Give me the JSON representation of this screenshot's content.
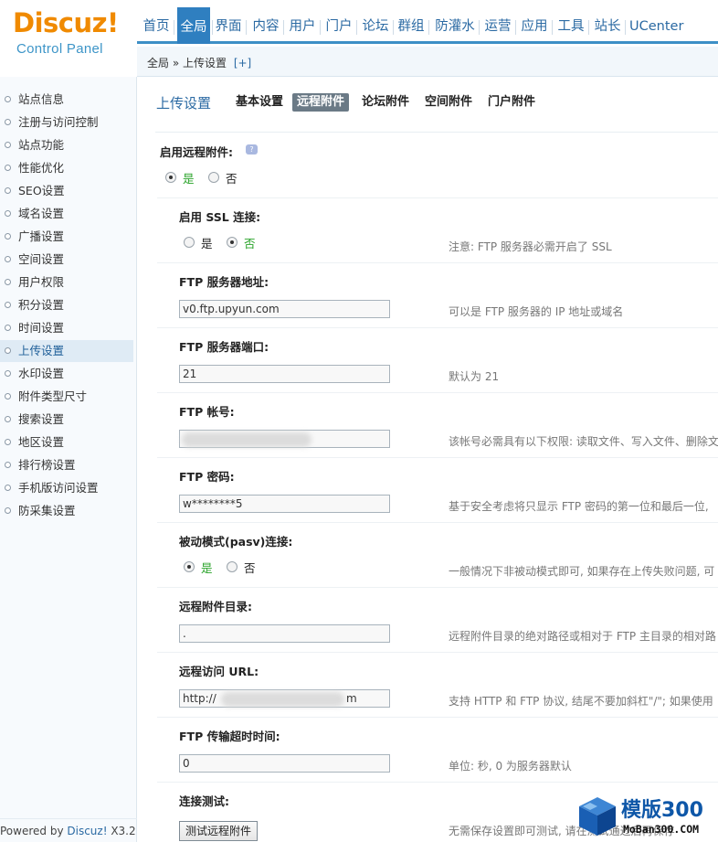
{
  "logo": {
    "brand": "Discuz",
    "bang": "!",
    "subtitle": "Control Panel"
  },
  "topnav": [
    {
      "label": "首页"
    },
    {
      "label": "全局"
    },
    {
      "label": "界面"
    },
    {
      "label": "内容"
    },
    {
      "label": "用户"
    },
    {
      "label": "门户"
    },
    {
      "label": "论坛"
    },
    {
      "label": "群组"
    },
    {
      "label": "防灌水"
    },
    {
      "label": "运营"
    },
    {
      "label": "应用"
    },
    {
      "label": "工具"
    },
    {
      "label": "站长"
    },
    {
      "label": "UCenter"
    }
  ],
  "active_topnav": "全局",
  "breadcrumb": {
    "path": "全局 » 上传设置",
    "add": "[+]"
  },
  "sidebar": {
    "items": [
      {
        "label": "站点信息"
      },
      {
        "label": "注册与访问控制"
      },
      {
        "label": "站点功能"
      },
      {
        "label": "性能优化"
      },
      {
        "label": "SEO设置"
      },
      {
        "label": "域名设置"
      },
      {
        "label": "广播设置"
      },
      {
        "label": "空间设置"
      },
      {
        "label": "用户权限"
      },
      {
        "label": "积分设置"
      },
      {
        "label": "时间设置"
      },
      {
        "label": "上传设置"
      },
      {
        "label": "水印设置"
      },
      {
        "label": "附件类型尺寸"
      },
      {
        "label": "搜索设置"
      },
      {
        "label": "地区设置"
      },
      {
        "label": "排行榜设置"
      },
      {
        "label": "手机版访问设置"
      },
      {
        "label": "防采集设置"
      }
    ],
    "active": "上传设置",
    "footer": {
      "prefix": "Powered by ",
      "brand": "Discuz!",
      "version": " X3.2"
    }
  },
  "subnav": {
    "title": "上传设置",
    "tabs": [
      {
        "label": "基本设置"
      },
      {
        "label": "远程附件"
      },
      {
        "label": "论坛附件"
      },
      {
        "label": "空间附件"
      },
      {
        "label": "门户附件"
      }
    ],
    "active_tab": "远程附件"
  },
  "form": {
    "enable_remote": {
      "label": "启用远程附件:",
      "yes": "是",
      "no": "否",
      "value": "yes"
    },
    "ssl": {
      "label": "启用 SSL 连接:",
      "yes": "是",
      "no": "否",
      "value": "no",
      "tip": "注意: FTP 服务器必需开启了 SSL"
    },
    "ftp_host": {
      "label": "FTP 服务器地址:",
      "value": "v0.ftp.upyun.com",
      "tip": "可以是 FTP 服务器的 IP 地址或域名"
    },
    "ftp_port": {
      "label": "FTP 服务器端口:",
      "value": "21",
      "tip": "默认为 21"
    },
    "ftp_user": {
      "label": "FTP 帐号:",
      "value": "",
      "tip": "该帐号必需具有以下权限: 读取文件、写入文件、删除文"
    },
    "ftp_pass": {
      "label": "FTP 密码:",
      "value": "w********5",
      "tip": "基于安全考虑将只显示 FTP 密码的第一位和最后一位,"
    },
    "pasv": {
      "label": "被动模式(pasv)连接:",
      "yes": "是",
      "no": "否",
      "value": "yes",
      "tip": "一般情况下非被动模式即可, 如果存在上传失败问题, 可"
    },
    "remote_dir": {
      "label": "远程附件目录:",
      "value": ".",
      "tip": "远程附件目录的绝对路径或相对于 FTP 主目录的相对路"
    },
    "remote_url": {
      "label": "远程访问 URL:",
      "value": "http://",
      "value_tail": "m",
      "tip": "支持 HTTP 和 FTP 协议, 结尾不要加斜杠\"/\"; 如果使用"
    },
    "timeout": {
      "label": "FTP 传输超时时间:",
      "value": "0",
      "tip": "单位: 秒, 0 为服务器默认"
    },
    "test": {
      "label": "连接测试:",
      "button": "测试远程附件",
      "tip": "无需保存设置即可测试, 请在测试通过后再保存"
    }
  },
  "watermark": {
    "name": "模版300",
    "url": "MoBan300.COM"
  },
  "colors": {
    "accent": "#2f7fc0",
    "link": "#2b6aa3",
    "logo": "#f08a00",
    "green": "#2aa32a"
  }
}
